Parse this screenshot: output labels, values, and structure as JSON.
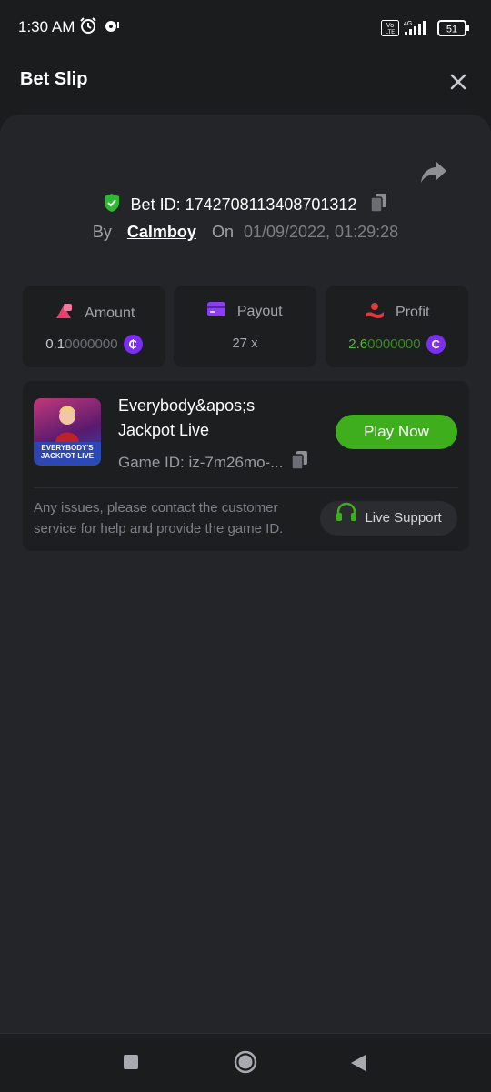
{
  "status_bar": {
    "time": "1:30 AM",
    "battery": "51",
    "network": "4G",
    "volte": "Vo LTE"
  },
  "header": {
    "title": "Bet Slip"
  },
  "bet": {
    "id_label": "Bet ID: 1742708113408701312",
    "by_label": "By",
    "user": "Calmboy",
    "on_label": "On",
    "datetime": "01/09/2022, 01:29:28"
  },
  "stats": {
    "amount": {
      "label": "Amount",
      "value_main": "0.1",
      "value_dim": "0000000"
    },
    "payout": {
      "label": "Payout",
      "value": "27 x"
    },
    "profit": {
      "label": "Profit",
      "value_main": "2.6",
      "value_dim": "0000000"
    }
  },
  "coin_symbol": "₵",
  "game": {
    "name": "Everybody&apos;s Jackpot Live",
    "thumb_text": "EVERYBODY'S JACKPOT LIVE",
    "game_id": "Game ID: iz-7m26mo-...",
    "play_label": "Play Now"
  },
  "support": {
    "text": "Any issues, please contact the customer service for help and provide the game ID.",
    "button_label": "Live Support"
  },
  "colors": {
    "accent_green": "#3fae1d",
    "profit_green": "#4cc320",
    "coin_purple": "#7b2ef0",
    "amount_pink": "#e83f6f",
    "payout_purple": "#8b3ff0",
    "profit_red": "#e0393e"
  }
}
